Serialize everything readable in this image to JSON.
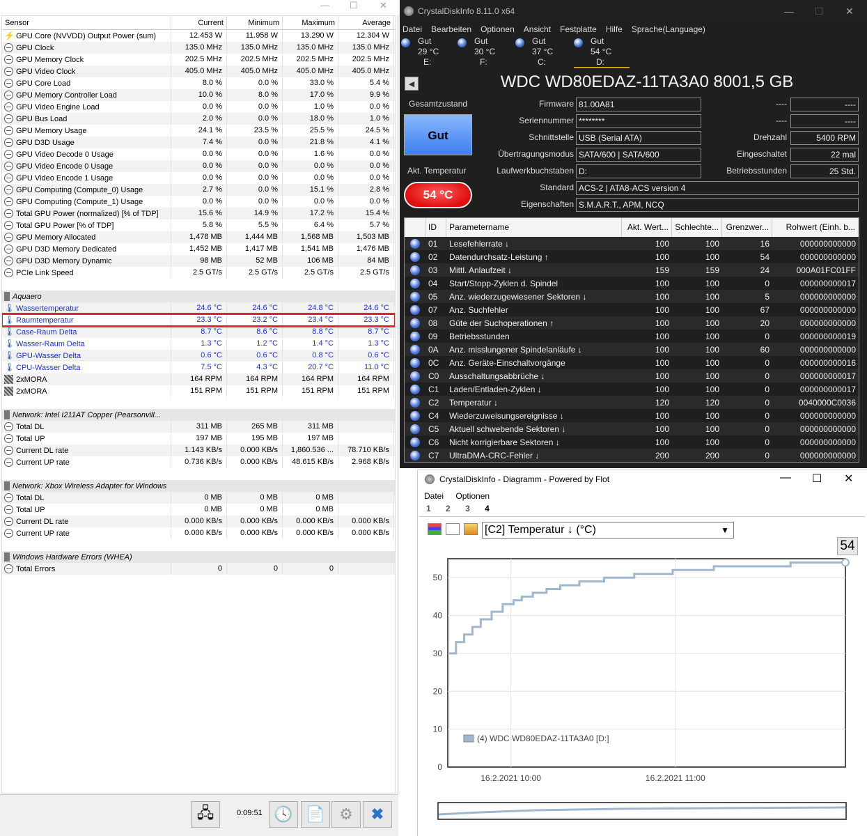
{
  "hwinfo": {
    "columns": [
      "Sensor",
      "Current",
      "Minimum",
      "Maximum",
      "Average"
    ],
    "rows": [
      {
        "icon": "bolt",
        "name": "GPU Core (NVVDD) Output Power (sum)",
        "v": [
          "12.453 W",
          "11.958 W",
          "13.290 W",
          "12.304 W"
        ]
      },
      {
        "icon": "clock",
        "name": "GPU Clock",
        "v": [
          "135.0 MHz",
          "135.0 MHz",
          "135.0 MHz",
          "135.0 MHz"
        ]
      },
      {
        "icon": "clock",
        "name": "GPU Memory Clock",
        "v": [
          "202.5 MHz",
          "202.5 MHz",
          "202.5 MHz",
          "202.5 MHz"
        ]
      },
      {
        "icon": "clock",
        "name": "GPU Video Clock",
        "v": [
          "405.0 MHz",
          "405.0 MHz",
          "405.0 MHz",
          "405.0 MHz"
        ]
      },
      {
        "icon": "clock",
        "name": "GPU Core Load",
        "v": [
          "8.0 %",
          "0.0 %",
          "33.0 %",
          "5.4 %"
        ]
      },
      {
        "icon": "clock",
        "name": "GPU Memory Controller Load",
        "v": [
          "10.0 %",
          "8.0 %",
          "17.0 %",
          "9.9 %"
        ]
      },
      {
        "icon": "clock",
        "name": "GPU Video Engine Load",
        "v": [
          "0.0 %",
          "0.0 %",
          "1.0 %",
          "0.0 %"
        ]
      },
      {
        "icon": "clock",
        "name": "GPU Bus Load",
        "v": [
          "2.0 %",
          "0.0 %",
          "18.0 %",
          "1.0 %"
        ]
      },
      {
        "icon": "clock",
        "name": "GPU Memory Usage",
        "v": [
          "24.1 %",
          "23.5 %",
          "25.5 %",
          "24.5 %"
        ]
      },
      {
        "icon": "clock",
        "name": "GPU D3D Usage",
        "v": [
          "7.4 %",
          "0.0 %",
          "21.8 %",
          "4.1 %"
        ]
      },
      {
        "icon": "clock",
        "name": "GPU Video Decode 0 Usage",
        "v": [
          "0.0 %",
          "0.0 %",
          "1.6 %",
          "0.0 %"
        ]
      },
      {
        "icon": "clock",
        "name": "GPU Video Encode 0 Usage",
        "v": [
          "0.0 %",
          "0.0 %",
          "0.0 %",
          "0.0 %"
        ]
      },
      {
        "icon": "clock",
        "name": "GPU Video Encode 1 Usage",
        "v": [
          "0.0 %",
          "0.0 %",
          "0.0 %",
          "0.0 %"
        ]
      },
      {
        "icon": "clock",
        "name": "GPU Computing (Compute_0) Usage",
        "v": [
          "2.7 %",
          "0.0 %",
          "15.1 %",
          "2.8 %"
        ]
      },
      {
        "icon": "clock",
        "name": "GPU Computing (Compute_1) Usage",
        "v": [
          "0.0 %",
          "0.0 %",
          "0.0 %",
          "0.0 %"
        ]
      },
      {
        "icon": "clock",
        "name": "Total GPU Power (normalized) [% of TDP]",
        "v": [
          "15.6 %",
          "14.9 %",
          "17.2 %",
          "15.4 %"
        ]
      },
      {
        "icon": "clock",
        "name": "Total GPU Power [% of TDP]",
        "v": [
          "5.8 %",
          "5.5 %",
          "6.4 %",
          "5.7 %"
        ]
      },
      {
        "icon": "clock",
        "name": "GPU Memory Allocated",
        "v": [
          "1,478 MB",
          "1,444 MB",
          "1,568 MB",
          "1,503 MB"
        ]
      },
      {
        "icon": "clock",
        "name": "GPU D3D Memory Dedicated",
        "v": [
          "1,452 MB",
          "1,417 MB",
          "1,541 MB",
          "1,476 MB"
        ]
      },
      {
        "icon": "clock",
        "name": "GPU D3D Memory Dynamic",
        "v": [
          "98 MB",
          "52 MB",
          "106 MB",
          "84 MB"
        ]
      },
      {
        "icon": "clock",
        "name": "PCIe Link Speed",
        "v": [
          "2.5 GT/s",
          "2.5 GT/s",
          "2.5 GT/s",
          "2.5 GT/s"
        ]
      },
      {
        "type": "blank"
      },
      {
        "type": "group",
        "name": "Aquaero"
      },
      {
        "icon": "therm",
        "blue": true,
        "name": "Wassertemperatur",
        "v": [
          "24.6 °C",
          "24.6 °C",
          "24.8 °C",
          "24.6 °C"
        ]
      },
      {
        "icon": "therm",
        "blue": true,
        "highlight": true,
        "name": "Raumtemperatur",
        "v": [
          "23.3 °C",
          "23.2 °C",
          "23.4 °C",
          "23.3 °C"
        ]
      },
      {
        "icon": "therm",
        "blue": true,
        "name": "Case-Raum Delta",
        "v": [
          "8.7 °C",
          "8.6 °C",
          "8.8 °C",
          "8.7 °C"
        ]
      },
      {
        "icon": "therm",
        "blue": true,
        "name": "Wasser-Raum Delta",
        "v": [
          "1.3 °C",
          "1.2 °C",
          "1.4 °C",
          "1.3 °C"
        ]
      },
      {
        "icon": "therm",
        "blue": true,
        "name": "GPU-Wasser Delta",
        "v": [
          "0.6 °C",
          "0.6 °C",
          "0.8 °C",
          "0.6 °C"
        ]
      },
      {
        "icon": "therm",
        "blue": true,
        "name": "CPU-Wasser Delta",
        "v": [
          "7.5 °C",
          "4.3 °C",
          "20.7 °C",
          "11.0 °C"
        ]
      },
      {
        "icon": "fan",
        "name": "2xMORA",
        "v": [
          "164 RPM",
          "164 RPM",
          "164 RPM",
          "164 RPM"
        ]
      },
      {
        "icon": "fan",
        "name": "2xMORA",
        "v": [
          "151 RPM",
          "151 RPM",
          "151 RPM",
          "151 RPM"
        ]
      },
      {
        "type": "blank"
      },
      {
        "type": "group",
        "name": "Network: Intel I211AT Copper (Pearsonvill..."
      },
      {
        "icon": "clock",
        "name": "Total DL",
        "v": [
          "311 MB",
          "265 MB",
          "311 MB",
          ""
        ]
      },
      {
        "icon": "clock",
        "name": "Total UP",
        "v": [
          "197 MB",
          "195 MB",
          "197 MB",
          ""
        ]
      },
      {
        "icon": "clock",
        "name": "Current DL rate",
        "v": [
          "1.143 KB/s",
          "0.000 KB/s",
          "1,860.536 ...",
          "78.710 KB/s"
        ]
      },
      {
        "icon": "clock",
        "name": "Current UP rate",
        "v": [
          "0.736 KB/s",
          "0.000 KB/s",
          "48.615 KB/s",
          "2.968 KB/s"
        ]
      },
      {
        "type": "blank"
      },
      {
        "type": "group",
        "name": "Network: Xbox Wireless Adapter for Windows"
      },
      {
        "icon": "clock",
        "name": "Total DL",
        "v": [
          "0 MB",
          "0 MB",
          "0 MB",
          ""
        ]
      },
      {
        "icon": "clock",
        "name": "Total UP",
        "v": [
          "0 MB",
          "0 MB",
          "0 MB",
          ""
        ]
      },
      {
        "icon": "clock",
        "name": "Current DL rate",
        "v": [
          "0.000 KB/s",
          "0.000 KB/s",
          "0.000 KB/s",
          "0.000 KB/s"
        ]
      },
      {
        "icon": "clock",
        "name": "Current UP rate",
        "v": [
          "0.000 KB/s",
          "0.000 KB/s",
          "0.000 KB/s",
          "0.000 KB/s"
        ]
      },
      {
        "type": "blank"
      },
      {
        "type": "group",
        "name": "Windows Hardware Errors (WHEA)"
      },
      {
        "icon": "clock",
        "name": "Total Errors",
        "v": [
          "0",
          "0",
          "0",
          ""
        ]
      }
    ],
    "timer": "0:09:51",
    "highlight_color": "#e5212b"
  },
  "cdi": {
    "title": "CrystalDiskInfo 8.11.0 x64",
    "menu": [
      "Datei",
      "Bearbeiten",
      "Optionen",
      "Ansicht",
      "Festplatte",
      "Hilfe",
      "Sprache(Language)"
    ],
    "drives": [
      {
        "status": "Gut",
        "temp": "29 °C",
        "letter": "E:"
      },
      {
        "status": "Gut",
        "temp": "30 °C",
        "letter": "F:"
      },
      {
        "status": "Gut",
        "temp": "37 °C",
        "letter": "C:"
      },
      {
        "status": "Gut",
        "temp": "54 °C",
        "letter": "D:"
      }
    ],
    "model": "WDC WD80EDAZ-11TA3A0 8001,5 GB",
    "health_label": "Gesamtzustand",
    "health": "Gut",
    "temp_label": "Akt. Temperatur",
    "temp": "54 °C",
    "fields": {
      "firmware_label": "Firmware",
      "firmware": "81.00A81",
      "serial_label": "Seriennummer",
      "serial": "********",
      "iface_label": "Schnittstelle",
      "iface": "USB (Serial ATA)",
      "mode_label": "Übertragungsmodus",
      "mode": "SATA/600 | SATA/600",
      "letter_label": "Laufwerkbuchstaben",
      "letter": "D:",
      "standard_label": "Standard",
      "standard": "ACS-2 | ATA8-ACS version 4",
      "features_label": "Eigenschaften",
      "features": "S.M.A.R.T., APM, NCQ",
      "r1_label": "----",
      "r1": "----",
      "r2_label": "----",
      "r2": "----",
      "rpm_label": "Drehzahl",
      "rpm": "5400 RPM",
      "count_label": "Eingeschaltet",
      "count": "22 mal",
      "hours_label": "Betriebsstunden",
      "hours": "25 Std."
    },
    "smart_columns": [
      "",
      "ID",
      "Parametername",
      "Akt. Wert...",
      "Schlechte...",
      "Grenzwer...",
      "Rohwert (Einh. b..."
    ],
    "smart": [
      [
        "01",
        "Lesefehlerrate ↓",
        "100",
        "100",
        "16",
        "000000000000"
      ],
      [
        "02",
        "Datendurchsatz-Leistung ↑",
        "100",
        "100",
        "54",
        "000000000000"
      ],
      [
        "03",
        "Mittl. Anlaufzeit ↓",
        "159",
        "159",
        "24",
        "000A01FC01FF"
      ],
      [
        "04",
        "Start/Stopp-Zyklen d. Spindel",
        "100",
        "100",
        "0",
        "000000000017"
      ],
      [
        "05",
        "Anz. wiederzugewiesener Sektoren ↓",
        "100",
        "100",
        "5",
        "000000000000"
      ],
      [
        "07",
        "Anz. Suchfehler",
        "100",
        "100",
        "67",
        "000000000000"
      ],
      [
        "08",
        "Güte der Suchoperationen ↑",
        "100",
        "100",
        "20",
        "000000000000"
      ],
      [
        "09",
        "Betriebsstunden",
        "100",
        "100",
        "0",
        "000000000019"
      ],
      [
        "0A",
        "Anz. misslungener Spindelanläufe ↓",
        "100",
        "100",
        "60",
        "000000000000"
      ],
      [
        "0C",
        "Anz. Geräte-Einschaltvorgänge",
        "100",
        "100",
        "0",
        "000000000016"
      ],
      [
        "C0",
        "Ausschaltungsabbrüche ↓",
        "100",
        "100",
        "0",
        "000000000017"
      ],
      [
        "C1",
        "Laden/Entladen-Zyklen ↓",
        "100",
        "100",
        "0",
        "000000000017"
      ],
      [
        "C2",
        "Temperatur ↓",
        "120",
        "120",
        "0",
        "0040000C0036"
      ],
      [
        "C4",
        "Wiederzuweisungsereignisse ↓",
        "100",
        "100",
        "0",
        "000000000000"
      ],
      [
        "C5",
        "Aktuell schwebende Sektoren ↓",
        "100",
        "100",
        "0",
        "000000000000"
      ],
      [
        "C6",
        "Nicht korrigierbare Sektoren ↓",
        "100",
        "100",
        "0",
        "000000000000"
      ],
      [
        "C7",
        "UltraDMA-CRC-Fehler ↓",
        "200",
        "200",
        "0",
        "000000000000"
      ]
    ]
  },
  "diagram": {
    "title": "CrystalDiskInfo - Diagramm - Powered by Flot",
    "menu": [
      "Datei",
      "Optionen"
    ],
    "tabs": [
      "1",
      "2",
      "3",
      "4"
    ],
    "active_tab": "4",
    "select": "[C2] Temperatur ↓ (°C)",
    "last_value": "54",
    "chart_data": {
      "type": "line",
      "step": true,
      "series": [
        {
          "name": "(4) WDC WD80EDAZ-11TA3A0 [D:]",
          "points": [
            [
              0,
              30
            ],
            [
              3,
              30
            ],
            [
              3,
              33
            ],
            [
              6,
              33
            ],
            [
              6,
              35
            ],
            [
              9,
              35
            ],
            [
              9,
              37
            ],
            [
              12,
              37
            ],
            [
              12,
              39
            ],
            [
              16,
              39
            ],
            [
              16,
              41
            ],
            [
              20,
              41
            ],
            [
              20,
              43
            ],
            [
              24,
              43
            ],
            [
              24,
              44
            ],
            [
              27,
              44
            ],
            [
              27,
              45
            ],
            [
              31,
              45
            ],
            [
              31,
              46
            ],
            [
              36,
              46
            ],
            [
              36,
              47
            ],
            [
              41,
              47
            ],
            [
              41,
              48
            ],
            [
              48,
              48
            ],
            [
              48,
              49
            ],
            [
              57,
              49
            ],
            [
              57,
              50
            ],
            [
              68,
              50
            ],
            [
              68,
              51
            ],
            [
              82,
              51
            ],
            [
              82,
              52
            ],
            [
              97,
              52
            ],
            [
              97,
              53
            ],
            [
              125,
              53
            ],
            [
              125,
              54
            ],
            [
              145,
              54
            ]
          ]
        }
      ],
      "x_ticks": [
        {
          "pos": 23,
          "label": "16.2.2021 10:00"
        },
        {
          "pos": 83,
          "label": "16.2.2021 11:00"
        }
      ],
      "ylim": [
        0,
        55
      ],
      "y_ticks": [
        0,
        10,
        20,
        30,
        40,
        50
      ],
      "xlim": [
        0,
        145
      ],
      "grid": true,
      "legend": "bottom-left",
      "line_color": "#9fb8cf"
    }
  }
}
